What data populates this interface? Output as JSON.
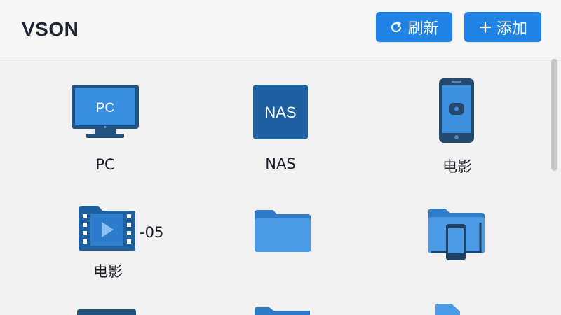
{
  "app": {
    "title": "VSON"
  },
  "toolbar": {
    "refresh_label": "刷新",
    "add_label": "添加"
  },
  "items": [
    {
      "label": "PC",
      "icon": "monitor-icon",
      "screen_text": "PC"
    },
    {
      "label": "NAS",
      "icon": "nas-icon",
      "screen_text": "NAS"
    },
    {
      "label": "电影",
      "icon": "phone-icon"
    },
    {
      "label": "电影",
      "icon": "video-folder-icon",
      "suffix": "-05"
    },
    {
      "label": "",
      "icon": "folder-icon"
    },
    {
      "label": "",
      "icon": "device-folder-icon"
    }
  ],
  "colors": {
    "accent": "#1f84e6",
    "icon_dark": "#1e5f9f",
    "icon_mid": "#2d7fd1",
    "icon_light": "#4b9ae4"
  }
}
